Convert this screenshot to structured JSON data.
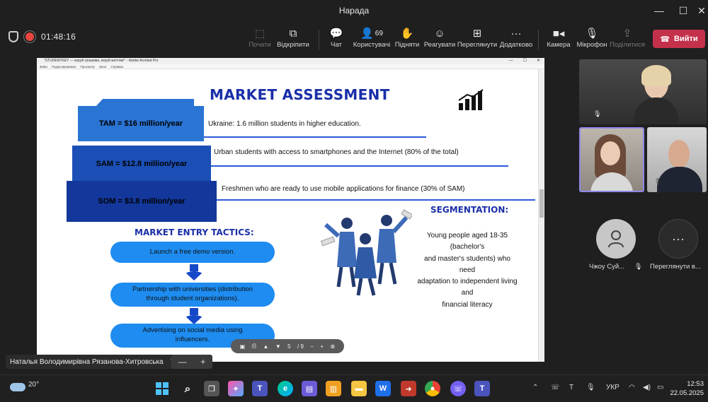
{
  "window": {
    "title": "Нарада"
  },
  "call": {
    "timer": "01:48:16"
  },
  "toolbar": {
    "start": "Почати",
    "unpin": "Відкріпити",
    "chat": "Чат",
    "people": "Користувачі",
    "people_count": "69",
    "raise": "Підняти",
    "react": "Реагувати",
    "view": "Переглянути",
    "more": "Додатково",
    "camera": "Камера",
    "mic": "Мікрофон",
    "share": "Поділитися",
    "leave": "Вийти"
  },
  "acrobat": {
    "title": "\"STUDENTKEY — керуй грошима, керуй життям!\" - Adobe Acrobat Pro",
    "menu": [
      "Файл",
      "Редактирование",
      "Просмотр",
      "Окно",
      "Справка"
    ]
  },
  "slide": {
    "title": "MARKET ASSESSMENT",
    "tam_label": "TAM = $16 million/year",
    "tam_desc": "Ukraine: 1.6 million students in higher education.",
    "sam_label": "SAM = $12.8 million/year",
    "sam_desc": "Urban students with access to smartphones and the Internet (80% of the total)",
    "som_label": "SOM = $3.8 million/year",
    "som_desc": "Freshmen who are ready to use mobile applications for finance (30% of SAM)",
    "tactics_title": "MARKET ENTRY TACTICS:",
    "tactics": [
      "Launch a free demo version.",
      "Partnership with universities (distribution through student organizations).",
      "Advertising on social media using influencers."
    ],
    "segmentation_title": "SEGMENTATION:",
    "segmentation_lines": [
      "Young people aged 18-35",
      "(bachelor's",
      "and master's students) who",
      "need",
      "adaptation to independent living",
      "and",
      "financial literacy"
    ]
  },
  "pdf_toolbar": {
    "page": "5",
    "total": "/ 9"
  },
  "presenter": {
    "name": "Наталья Володимирівна Рязанова-Хитровська"
  },
  "participants": [
    {
      "name": "Чжоу Суй..."
    },
    {
      "name": "Переглянути в..."
    }
  ],
  "taskbar": {
    "temperature": "20°",
    "language": "УКР",
    "time": "12:53",
    "date": "22.05.2025"
  }
}
